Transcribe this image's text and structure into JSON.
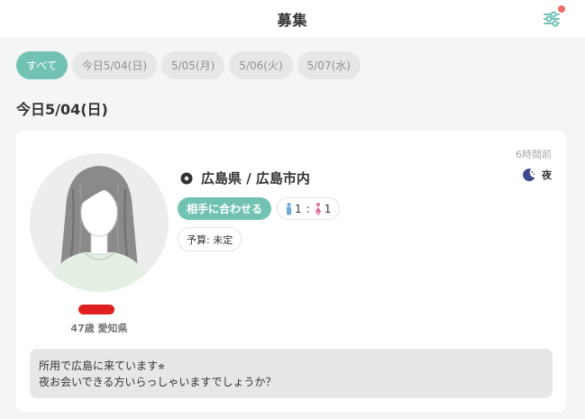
{
  "header": {
    "title": "募集"
  },
  "tabs": [
    {
      "label": "すべて",
      "active": true
    },
    {
      "label": "今日5/04(日)",
      "active": false
    },
    {
      "label": "5/05(月)",
      "active": false
    },
    {
      "label": "5/06(火)",
      "active": false
    },
    {
      "label": "5/07(水)",
      "active": false
    }
  ],
  "section": {
    "title": "今日5/04(日)"
  },
  "post": {
    "posted_ago": "6時間前",
    "time_of_day": "夜",
    "location": "広島県 / 広島市内",
    "match_label": "相手に合わせる",
    "male_count": "1",
    "separator": ":",
    "female_count": "1",
    "budget": "予算: 未定",
    "user_meta": "47歳 愛知県",
    "message_line1": "所用で広島に来ています⭐︎",
    "message_line2": "夜お会いできる方いらっしゃいますでしょうか？"
  },
  "icons": {
    "filter": "sliders-icon",
    "location": "location-pin-icon",
    "time_of_day": "moon-icon",
    "male": "male-person-icon",
    "female": "female-person-icon"
  },
  "colors": {
    "accent": "#72c2b4",
    "notification": "#f06b6b",
    "name_redaction": "#e02020",
    "male": "#6aa9d8",
    "female": "#e56b9c",
    "moon": "#3e4a8c"
  }
}
